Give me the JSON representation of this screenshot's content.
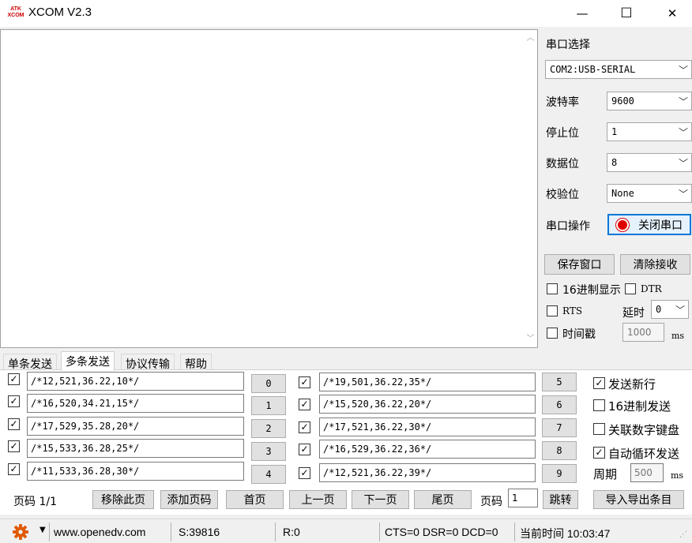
{
  "titlebar": {
    "icon_top": "ATK",
    "icon_bottom": "XCOM",
    "title": "XCOM V2.3",
    "minimize": "—",
    "maximize": "☐",
    "close": "✕"
  },
  "settings": {
    "port_label": "串口选择",
    "port_value": "COM2:USB-SERIAL",
    "baud_label": "波特率",
    "baud_value": "9600",
    "stop_label": "停止位",
    "stop_value": "1",
    "data_label": "数据位",
    "data_value": "8",
    "parity_label": "校验位",
    "parity_value": "None",
    "op_label": "串口操作",
    "op_button": "关闭串口",
    "save_button": "保存窗口",
    "clear_button": "清除接收",
    "hex_display": "16进制显示",
    "dtr": "DTR",
    "rts": "RTS",
    "delay_label": "延时",
    "delay_value": "0",
    "timestamp": "时间戳",
    "timestamp_value": "1000",
    "ms": "ms"
  },
  "tabs": [
    "单条发送",
    "多条发送",
    "协议传输",
    "帮助"
  ],
  "active_tab": 1,
  "multi_send": {
    "left": [
      {
        "text": "/*12,521,36.22,10*/",
        "btn": "0",
        "checked": true
      },
      {
        "text": "/*16,520,34.21,15*/",
        "btn": "1",
        "checked": true
      },
      {
        "text": "/*17,529,35.28,20*/",
        "btn": "2",
        "checked": true
      },
      {
        "text": "/*15,533,36.28,25*/",
        "btn": "3",
        "checked": true
      },
      {
        "text": "/*11,533,36.28,30*/",
        "btn": "4",
        "checked": true
      }
    ],
    "right": [
      {
        "text": "/*19,501,36.22,35*/",
        "btn": "5",
        "checked": true
      },
      {
        "text": "/*15,520,36.22,20*/",
        "btn": "6",
        "checked": true
      },
      {
        "text": "/*17,521,36.22,30*/",
        "btn": "7",
        "checked": true
      },
      {
        "text": "/*16,529,36.22,36*/",
        "btn": "8",
        "checked": true
      },
      {
        "text": "/*12,521,36.22,39*/",
        "btn": "9",
        "checked": true
      }
    ],
    "options": [
      {
        "label": "发送新行",
        "checked": true
      },
      {
        "label": "16进制发送",
        "checked": false
      },
      {
        "label": "关联数字键盘",
        "checked": false
      },
      {
        "label": "自动循环发送",
        "checked": true
      }
    ],
    "period_label": "周期",
    "period_value": "500",
    "ms": "ms"
  },
  "bottom": {
    "page_info": "页码 1/1",
    "remove_page": "移除此页",
    "add_page": "添加页码",
    "first": "首页",
    "prev": "上一页",
    "next": "下一页",
    "last": "尾页",
    "page_label": "页码",
    "page_value": "1",
    "jump": "跳转",
    "import_export": "导入导出条目"
  },
  "status": {
    "url": "www.openedv.com",
    "sent": "S:39816",
    "recv": "R:0",
    "signals": "CTS=0 DSR=0 DCD=0",
    "time": "当前时间 10:03:47"
  },
  "colors": {
    "accent": "#0078d7",
    "record": "#e00000",
    "gear": "#e05a00"
  }
}
